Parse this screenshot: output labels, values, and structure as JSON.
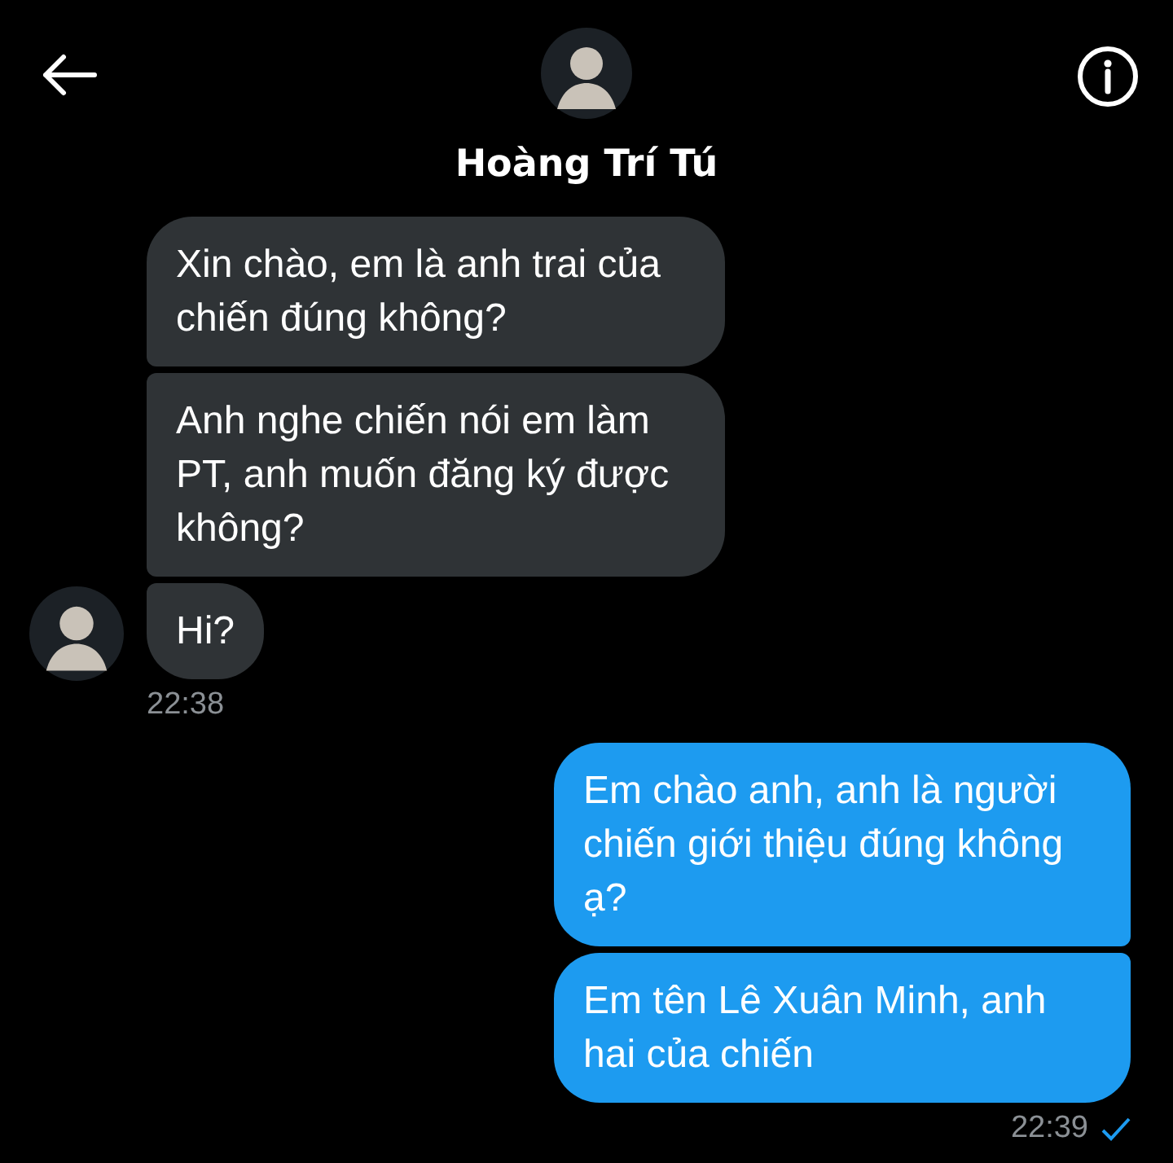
{
  "header": {
    "name": "Hoàng Trí Tú"
  },
  "groups": [
    {
      "kind": "received",
      "messages": [
        "Xin chào, em là anh trai của chiến đúng không?",
        "Anh nghe chiến nói em làm PT, anh muốn đăng ký được không?",
        "Hi?"
      ],
      "time": "22:38"
    },
    {
      "kind": "sent",
      "messages": [
        "Em chào anh, anh là người chiến giới thiệu đúng không ạ?",
        "Em tên Lê Xuân Minh, anh hai của chiến"
      ],
      "time": "22:39",
      "read": true
    }
  ]
}
